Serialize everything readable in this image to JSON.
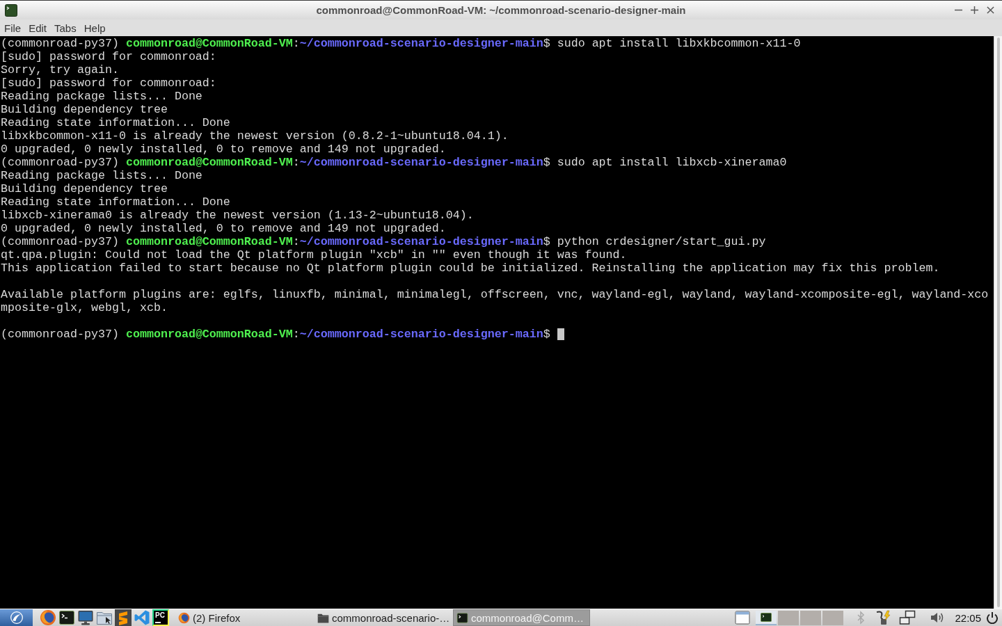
{
  "window": {
    "title": "commonroad@CommonRoad-VM: ~/commonroad-scenario-designer-main"
  },
  "menu": [
    "File",
    "Edit",
    "Tabs",
    "Help"
  ],
  "terminal": {
    "lines": [
      {
        "kind": "prompt",
        "env": "(commonroad-py37)",
        "user": "commonroad@CommonRoad-VM",
        "separator": ":",
        "path": "~/commonroad-scenario-designer-main",
        "symbol": "$",
        "command": "sudo apt install libxkbcommon-x11-0",
        "cursor": false
      },
      {
        "kind": "output",
        "text": "[sudo] password for commonroad:"
      },
      {
        "kind": "output",
        "text": "Sorry, try again."
      },
      {
        "kind": "output",
        "text": "[sudo] password for commonroad:"
      },
      {
        "kind": "output",
        "text": "Reading package lists... Done"
      },
      {
        "kind": "output",
        "text": "Building dependency tree"
      },
      {
        "kind": "output",
        "text": "Reading state information... Done"
      },
      {
        "kind": "output",
        "text": "libxkbcommon-x11-0 is already the newest version (0.8.2-1~ubuntu18.04.1)."
      },
      {
        "kind": "output",
        "text": "0 upgraded, 0 newly installed, 0 to remove and 149 not upgraded."
      },
      {
        "kind": "prompt",
        "env": "(commonroad-py37)",
        "user": "commonroad@CommonRoad-VM",
        "separator": ":",
        "path": "~/commonroad-scenario-designer-main",
        "symbol": "$",
        "command": "sudo apt install libxcb-xinerama0",
        "cursor": false
      },
      {
        "kind": "output",
        "text": "Reading package lists... Done"
      },
      {
        "kind": "output",
        "text": "Building dependency tree"
      },
      {
        "kind": "output",
        "text": "Reading state information... Done"
      },
      {
        "kind": "output",
        "text": "libxcb-xinerama0 is already the newest version (1.13-2~ubuntu18.04)."
      },
      {
        "kind": "output",
        "text": "0 upgraded, 0 newly installed, 0 to remove and 149 not upgraded."
      },
      {
        "kind": "prompt",
        "env": "(commonroad-py37)",
        "user": "commonroad@CommonRoad-VM",
        "separator": ":",
        "path": "~/commonroad-scenario-designer-main",
        "symbol": "$",
        "command": "python crdesigner/start_gui.py",
        "cursor": false
      },
      {
        "kind": "output",
        "text": "qt.qpa.plugin: Could not load the Qt platform plugin \"xcb\" in \"\" even though it was found."
      },
      {
        "kind": "output",
        "text": "This application failed to start because no Qt platform plugin could be initialized. Reinstalling the application may fix this problem."
      },
      {
        "kind": "blank"
      },
      {
        "kind": "output",
        "text": "Available platform plugins are: eglfs, linuxfb, minimal, minimalegl, offscreen, vnc, wayland-egl, wayland, wayland-xcomposite-egl, wayland-xco"
      },
      {
        "kind": "output",
        "text": "mposite-glx, webgl, xcb."
      },
      {
        "kind": "blank"
      },
      {
        "kind": "prompt",
        "env": "(commonroad-py37)",
        "user": "commonroad@CommonRoad-VM",
        "separator": ":",
        "path": "~/commonroad-scenario-designer-main",
        "symbol": "$",
        "cursor": true
      }
    ]
  },
  "taskbar": {
    "launchers": [
      {
        "kind": "globe"
      },
      {
        "kind": "terminal"
      },
      {
        "kind": "monitor"
      },
      {
        "kind": "folder"
      },
      {
        "kind": "stripes"
      },
      {
        "kind": "ribbon"
      },
      {
        "kind": "lettered",
        "text": "PC"
      }
    ],
    "tasks": [
      {
        "kind": "globe",
        "label": "(2) Firefox",
        "selected": false
      },
      {
        "kind": "folder",
        "label": "commonroad-scenario-…",
        "selected": false
      },
      {
        "kind": "terminal",
        "label": "commonroad@Comm…",
        "selected": true
      }
    ],
    "desktops": [
      {
        "kind": "terminal",
        "selected": true
      },
      {
        "kind": "empty",
        "selected": false
      },
      {
        "kind": "empty",
        "selected": false
      },
      {
        "kind": "empty",
        "selected": false
      }
    ],
    "clock": "22:05"
  }
}
